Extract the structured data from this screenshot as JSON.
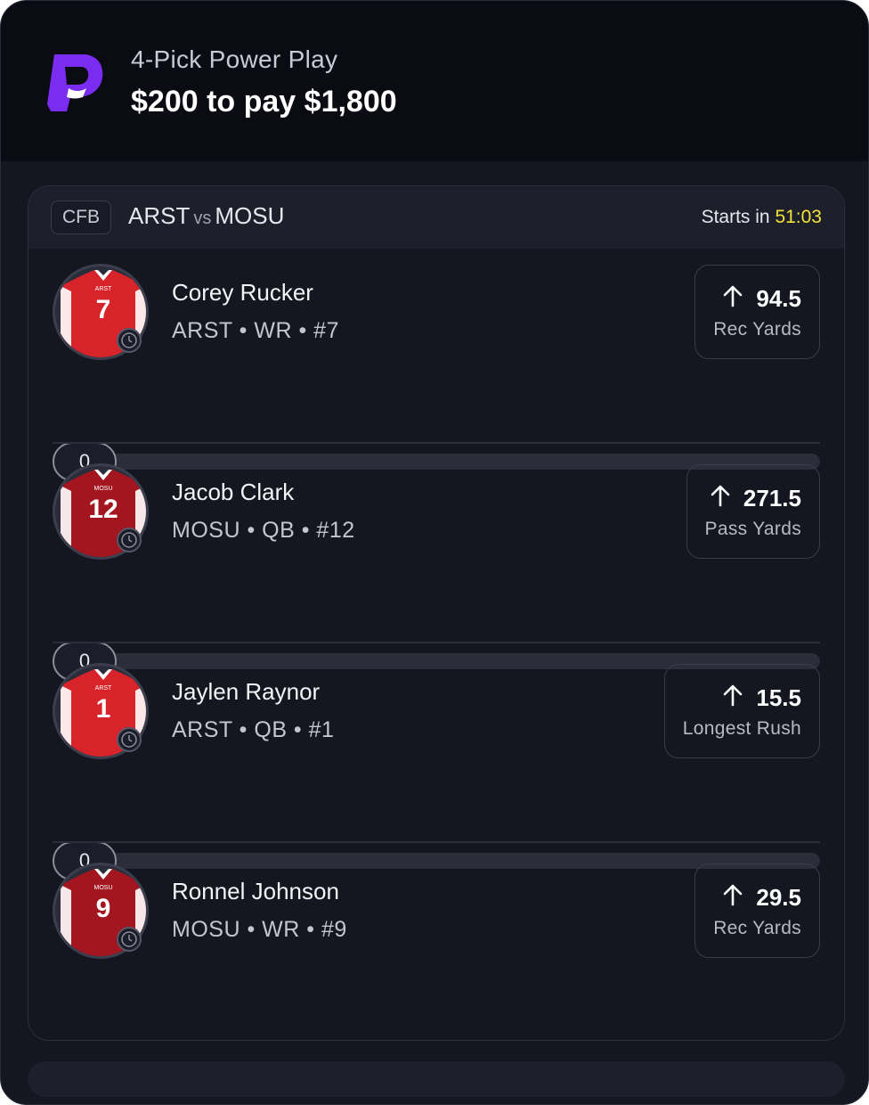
{
  "header": {
    "subtitle": "4-Pick Power Play",
    "title": "$200 to pay $1,800",
    "logo_icon": "prizepicks-logo-icon",
    "brand_color": "#7a2cf0"
  },
  "game": {
    "league": "CFB",
    "team_a": "ARST",
    "vs": "vs",
    "team_b": "MOSU",
    "starts_label": "Starts in",
    "starts_time": "51:03",
    "time_color": "#f2e33a"
  },
  "picks": [
    {
      "name": "Corey Rucker",
      "info": "ARST • WR • #7",
      "line": "94.5",
      "stat": "Rec Yards",
      "direction": "up-arrow-icon",
      "progress": "0",
      "jersey_team": "ARST",
      "jersey_number": "7",
      "jersey_color": "#d8232a"
    },
    {
      "name": "Jacob Clark",
      "info": "MOSU • QB • #12",
      "line": "271.5",
      "stat": "Pass Yards",
      "direction": "up-arrow-icon",
      "progress": "0",
      "jersey_team": "MOSU",
      "jersey_number": "12",
      "jersey_color": "#a3161f"
    },
    {
      "name": "Jaylen Raynor",
      "info": "ARST • QB • #1",
      "line": "15.5",
      "stat": "Longest Rush",
      "direction": "up-arrow-icon",
      "progress": "0",
      "jersey_team": "ARST",
      "jersey_number": "1",
      "jersey_color": "#d8232a"
    },
    {
      "name": "Ronnel Johnson",
      "info": "MOSU • WR • #9",
      "line": "29.5",
      "stat": "Rec Yards",
      "direction": "up-arrow-icon",
      "progress": "0",
      "jersey_team": "MOSU",
      "jersey_number": "9",
      "jersey_color": "#a3161f"
    }
  ]
}
